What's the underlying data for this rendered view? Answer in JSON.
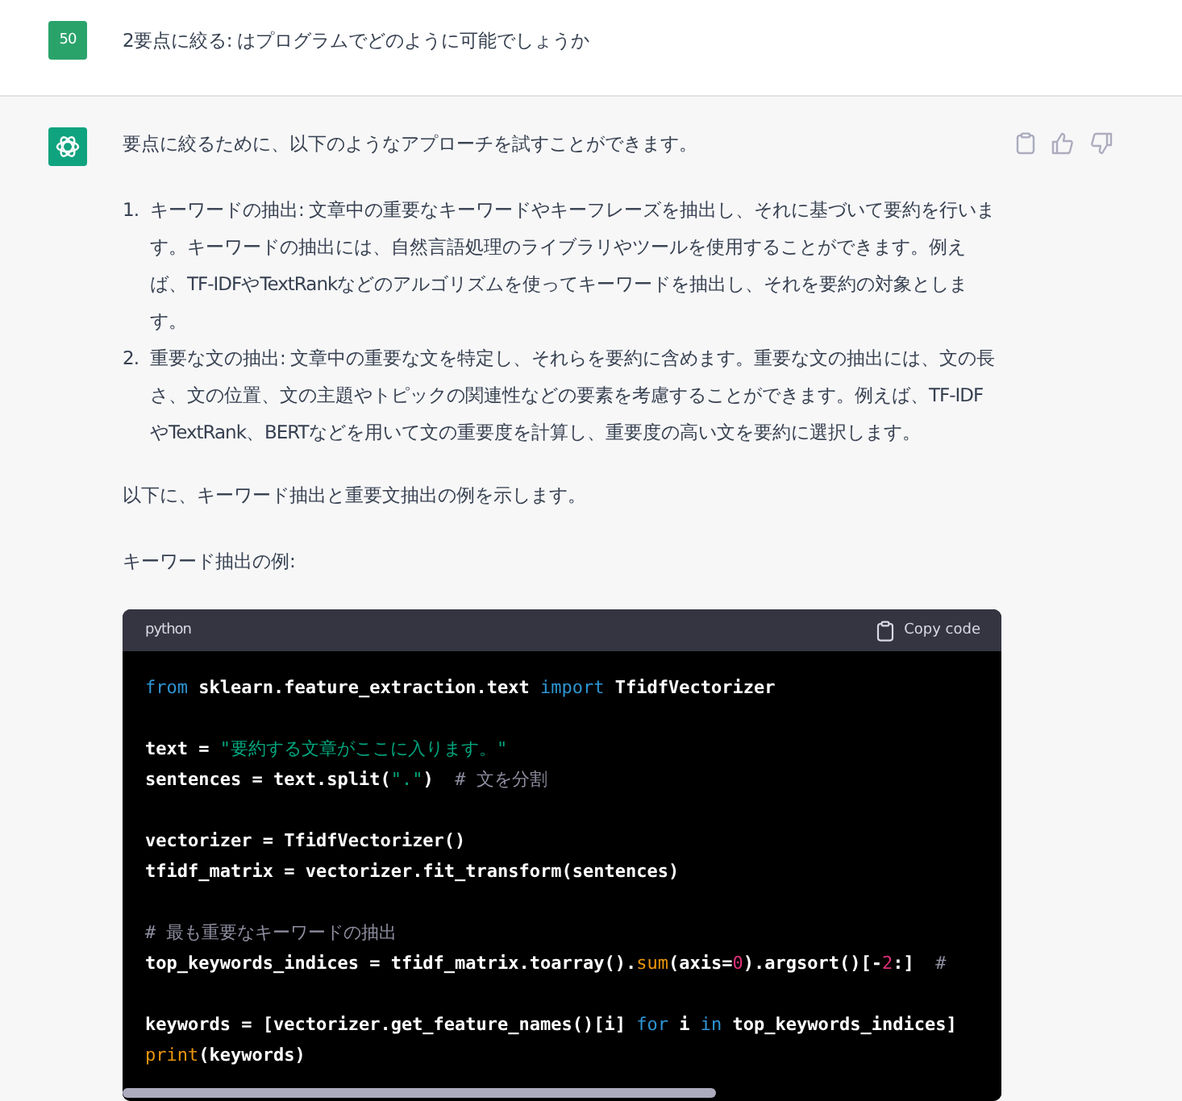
{
  "user_message": {
    "avatar": "50",
    "text": "2要点に絞る: はプログラムでどのように可能でしょうか"
  },
  "assistant_message": {
    "intro": "要点に絞るために、以下のようなアプローチを試すことができます。",
    "list": [
      {
        "number": "1.",
        "text": "キーワードの抽出: 文章中の重要なキーワードやキーフレーズを抽出し、それに基づいて要約を行います。キーワードの抽出には、自然言語処理のライブラリやツールを使用することができます。例えば、TF-IDFやTextRankなどのアルゴリズムを使ってキーワードを抽出し、それを要約の対象とします。"
      },
      {
        "number": "2.",
        "text": "重要な文の抽出: 文章中の重要な文を特定し、それらを要約に含めます。重要な文の抽出には、文の長さ、文の位置、文の主題やトピックの関連性などの要素を考慮することができます。例えば、TF-IDFやTextRank、BERTなどを用いて文の重要度を計算し、重要度の高い文を要約に選択します。"
      }
    ],
    "paragraphs": [
      "以下に、キーワード抽出と重要文抽出の例を示します。",
      "キーワード抽出の例:"
    ],
    "code_block": {
      "language": "python",
      "copy_label": "Copy code",
      "blocks": [
        [
          [
            {
              "kind": "kw",
              "text": "from"
            },
            {
              "kind": "plain",
              "text": " sklearn.feature_extraction.text "
            },
            {
              "kind": "kw",
              "text": "import"
            },
            {
              "kind": "plain",
              "text": " TfidfVectorizer"
            }
          ]
        ],
        [
          [
            {
              "kind": "plain",
              "text": "text = "
            },
            {
              "kind": "str",
              "text": "\"要約する文章がここに入ります。\""
            }
          ],
          [
            {
              "kind": "plain",
              "text": "sentences = text.split("
            },
            {
              "kind": "str",
              "text": "\".\""
            },
            {
              "kind": "plain",
              "text": ")  "
            },
            {
              "kind": "cmt",
              "text": "# 文を分割"
            }
          ]
        ],
        [
          [
            {
              "kind": "plain",
              "text": "vectorizer = TfidfVectorizer()"
            }
          ],
          [
            {
              "kind": "plain",
              "text": "tfidf_matrix = vectorizer.fit_transform(sentences)"
            }
          ]
        ],
        [
          [
            {
              "kind": "cmt",
              "text": "# 最も重要なキーワードの抽出"
            }
          ],
          [
            {
              "kind": "plain",
              "text": "top_keywords_indices = tfidf_matrix.toarray()."
            },
            {
              "kind": "fn",
              "text": "sum"
            },
            {
              "kind": "plain",
              "text": "(axis="
            },
            {
              "kind": "num",
              "text": "0"
            },
            {
              "kind": "plain",
              "text": ").argsort()[-"
            },
            {
              "kind": "num",
              "text": "2"
            },
            {
              "kind": "plain",
              "text": ":]  "
            },
            {
              "kind": "cmt",
              "text": "#"
            }
          ]
        ],
        [
          [
            {
              "kind": "plain",
              "text": "keywords = [vectorizer.get_feature_names()[i] "
            },
            {
              "kind": "kw",
              "text": "for"
            },
            {
              "kind": "plain",
              "text": " i "
            },
            {
              "kind": "kw",
              "text": "in"
            },
            {
              "kind": "plain",
              "text": " top_keywords_indices]"
            }
          ],
          [
            {
              "kind": "fn",
              "text": "print"
            },
            {
              "kind": "plain",
              "text": "(keywords)"
            }
          ]
        ]
      ]
    }
  }
}
